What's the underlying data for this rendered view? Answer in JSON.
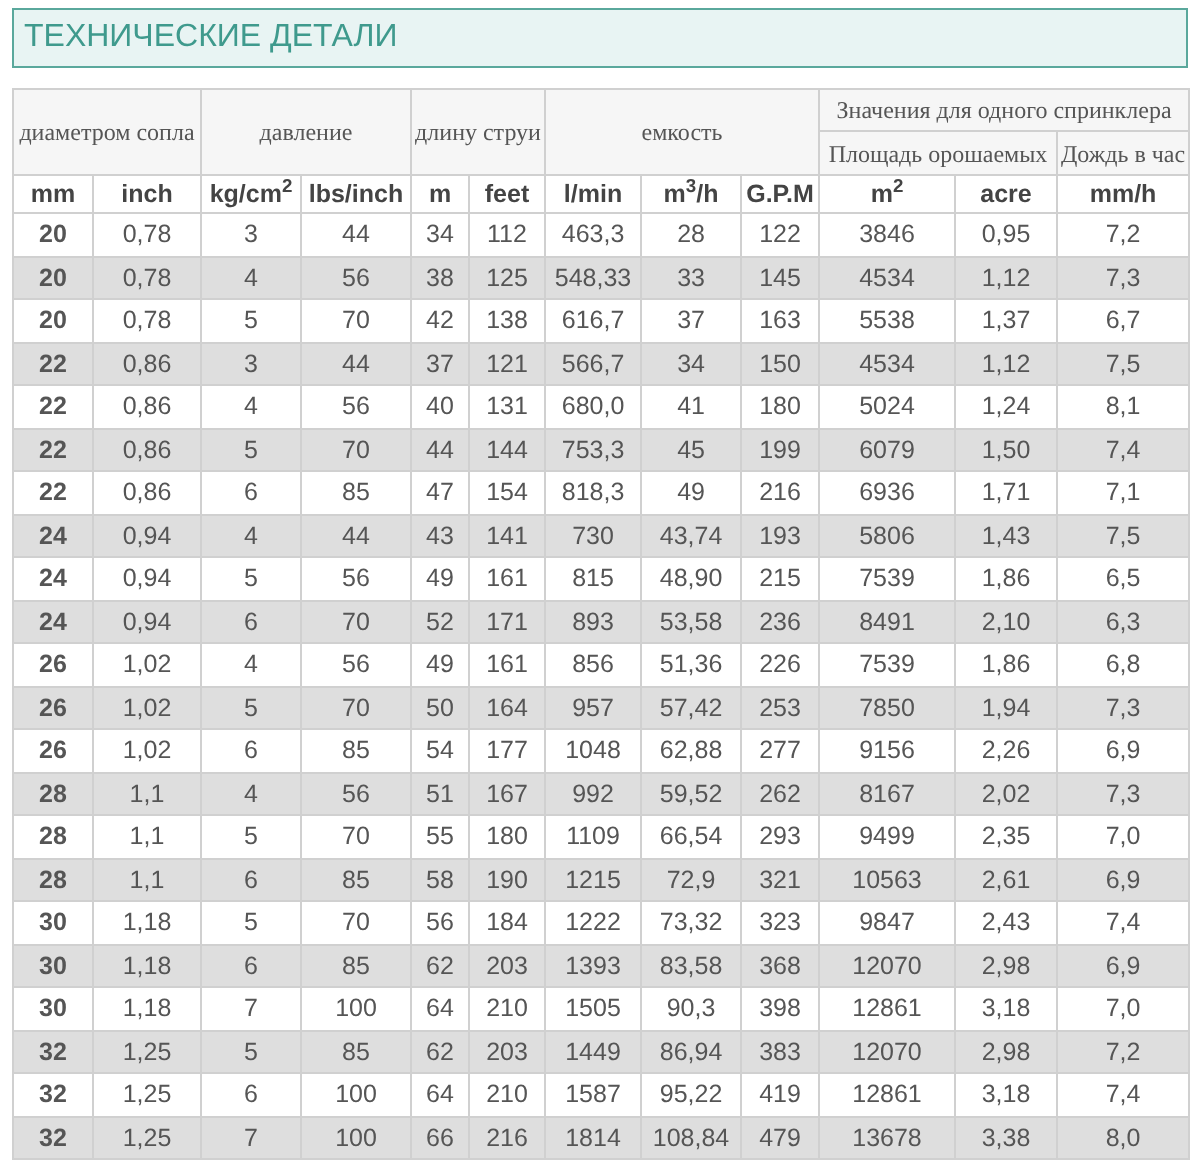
{
  "title": "ТЕХНИЧЕСКИЕ ДЕТАЛИ",
  "table": {
    "header_groups": [
      {
        "label": "диаметром сопла"
      },
      {
        "label": "давление"
      },
      {
        "label": "длину струи"
      },
      {
        "label": "емкость"
      },
      {
        "label": "Значения для одного спринклера",
        "subgroups": [
          {
            "label": "Площадь орошаемых"
          },
          {
            "label": "Дождь в час"
          }
        ]
      }
    ],
    "columns": [
      "mm",
      "inch",
      "kg/cm$^{2}$",
      "lbs/inch",
      "m",
      "feet",
      "l/min",
      "m$^{3}$/h",
      "G.P.M",
      "m$^{2}$",
      "acre",
      "mm/h"
    ],
    "rows": [
      [
        "20",
        "0,78",
        "3",
        "44",
        "34",
        "112",
        "463,3",
        "28",
        "122",
        "3846",
        "0,95",
        "7,2"
      ],
      [
        "20",
        "0,78",
        "4",
        "56",
        "38",
        "125",
        "548,33",
        "33",
        "145",
        "4534",
        "1,12",
        "7,3"
      ],
      [
        "20",
        "0,78",
        "5",
        "70",
        "42",
        "138",
        "616,7",
        "37",
        "163",
        "5538",
        "1,37",
        "6,7"
      ],
      [
        "22",
        "0,86",
        "3",
        "44",
        "37",
        "121",
        "566,7",
        "34",
        "150",
        "4534",
        "1,12",
        "7,5"
      ],
      [
        "22",
        "0,86",
        "4",
        "56",
        "40",
        "131",
        "680,0",
        "41",
        "180",
        "5024",
        "1,24",
        "8,1"
      ],
      [
        "22",
        "0,86",
        "5",
        "70",
        "44",
        "144",
        "753,3",
        "45",
        "199",
        "6079",
        "1,50",
        "7,4"
      ],
      [
        "22",
        "0,86",
        "6",
        "85",
        "47",
        "154",
        "818,3",
        "49",
        "216",
        "6936",
        "1,71",
        "7,1"
      ],
      [
        "24",
        "0,94",
        "4",
        "44",
        "43",
        "141",
        "730",
        "43,74",
        "193",
        "5806",
        "1,43",
        "7,5"
      ],
      [
        "24",
        "0,94",
        "5",
        "56",
        "49",
        "161",
        "815",
        "48,90",
        "215",
        "7539",
        "1,86",
        "6,5"
      ],
      [
        "24",
        "0,94",
        "6",
        "70",
        "52",
        "171",
        "893",
        "53,58",
        "236",
        "8491",
        "2,10",
        "6,3"
      ],
      [
        "26",
        "1,02",
        "4",
        "56",
        "49",
        "161",
        "856",
        "51,36",
        "226",
        "7539",
        "1,86",
        "6,8"
      ],
      [
        "26",
        "1,02",
        "5",
        "70",
        "50",
        "164",
        "957",
        "57,42",
        "253",
        "7850",
        "1,94",
        "7,3"
      ],
      [
        "26",
        "1,02",
        "6",
        "85",
        "54",
        "177",
        "1048",
        "62,88",
        "277",
        "9156",
        "2,26",
        "6,9"
      ],
      [
        "28",
        "1,1",
        "4",
        "56",
        "51",
        "167",
        "992",
        "59,52",
        "262",
        "8167",
        "2,02",
        "7,3"
      ],
      [
        "28",
        "1,1",
        "5",
        "70",
        "55",
        "180",
        "1109",
        "66,54",
        "293",
        "9499",
        "2,35",
        "7,0"
      ],
      [
        "28",
        "1,1",
        "6",
        "85",
        "58",
        "190",
        "1215",
        "72,9",
        "321",
        "10563",
        "2,61",
        "6,9"
      ],
      [
        "30",
        "1,18",
        "5",
        "70",
        "56",
        "184",
        "1222",
        "73,32",
        "323",
        "9847",
        "2,43",
        "7,4"
      ],
      [
        "30",
        "1,18",
        "6",
        "85",
        "62",
        "203",
        "1393",
        "83,58",
        "368",
        "12070",
        "2,98",
        "6,9"
      ],
      [
        "30",
        "1,18",
        "7",
        "100",
        "64",
        "210",
        "1505",
        "90,3",
        "398",
        "12861",
        "3,18",
        "7,0"
      ],
      [
        "32",
        "1,25",
        "5",
        "85",
        "62",
        "203",
        "1449",
        "86,94",
        "383",
        "12070",
        "2,98",
        "7,2"
      ],
      [
        "32",
        "1,25",
        "6",
        "100",
        "64",
        "210",
        "1587",
        "95,22",
        "419",
        "12861",
        "3,18",
        "7,4"
      ],
      [
        "32",
        "1,25",
        "7",
        "100",
        "66",
        "216",
        "1814",
        "108,84",
        "479",
        "13678",
        "3,38",
        "8,0"
      ]
    ]
  }
}
